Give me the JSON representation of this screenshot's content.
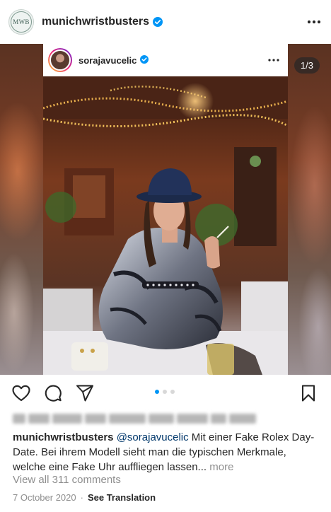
{
  "post": {
    "account": {
      "username": "munichwristbusters",
      "avatar_text": "MWB",
      "verified": true,
      "verified_icon": "verified-badge-icon",
      "more_icon": "more-horizontal-icon"
    },
    "embedded_post": {
      "username": "sorajavucelic",
      "verified": true,
      "more_icon": "more-horizontal-icon"
    },
    "carousel": {
      "counter": "1/3",
      "current": 1,
      "total": 3
    },
    "actions": {
      "like_icon": "heart-icon",
      "comment_icon": "comment-icon",
      "share_icon": "paper-plane-icon",
      "save_icon": "bookmark-icon"
    },
    "caption": {
      "username": "munichwristbusters",
      "mention": "@sorajavucelic",
      "text": " Mit einer Fake Rolex Day-Date. Bei ihrem Modell sieht man die typischen Merkmale, welche eine Fake Uhr auffliegen lassen...",
      "more_label": "more"
    },
    "comments_link": "View all 311 comments",
    "date": "7 October 2020",
    "separator": "·",
    "translate_label": "See Translation"
  },
  "colors": {
    "link_blue": "#00376b",
    "verified_blue": "#0095f6",
    "secondary_text": "#8e8e8e",
    "primary_text": "#262626"
  }
}
